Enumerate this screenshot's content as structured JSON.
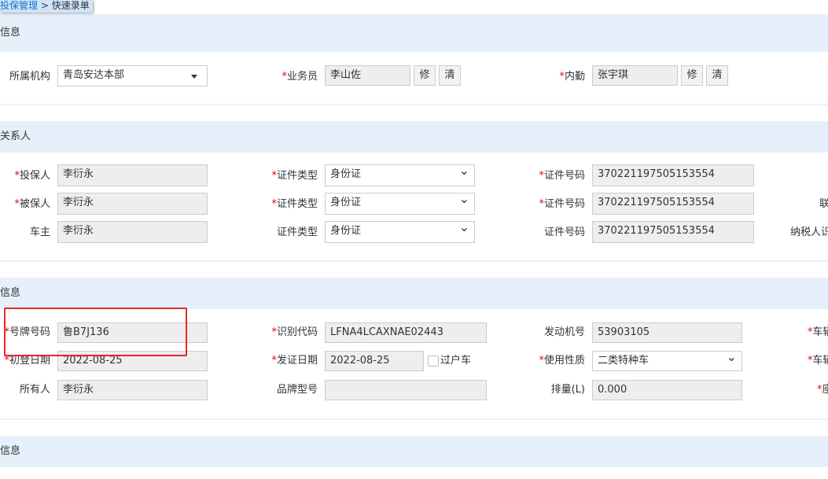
{
  "breadcrumb": {
    "link": "投保管理",
    "sep": " > ",
    "current": "快速录单"
  },
  "sections": [
    "本信息",
    "险关系人",
    "辆信息",
    "险信息"
  ],
  "basic": {
    "org_label": "所属机构",
    "org_value": "青岛安达本部",
    "sales_label": "业务员",
    "sales_value": "李山佐",
    "inner_label": "内勤",
    "inner_value": "张宇琪",
    "edit_btn": "修",
    "clear_btn": "清"
  },
  "parties": [
    {
      "role": "投保人",
      "required": true,
      "name": "李衍永",
      "idtype_label": "证件类型",
      "idtype": "身份证",
      "idno_label": "证件号码",
      "idno": "370221197505153554",
      "extra": ""
    },
    {
      "role": "被保人",
      "required": true,
      "name": "李衍永",
      "idtype_label": "证件类型",
      "idtype": "身份证",
      "idno_label": "证件号码",
      "idno": "370221197505153554",
      "extra": "联"
    },
    {
      "role": "车主",
      "required": false,
      "name": "李衍永",
      "idtype_label": "证件类型",
      "idtype": "身份证",
      "idno_label": "证件号码",
      "idno": "370221197505153554",
      "extra": "纳税人识"
    }
  ],
  "vehicle": {
    "plate_label": "号牌号码",
    "plate": "鲁B7J136",
    "vin_label": "识别代码",
    "vin": "LFNA4LCAXNAE02443",
    "engine_label": "发动机号",
    "engine": "53903105",
    "c4r1": "车辆",
    "reg_label": "初登日期",
    "reg": "2022-08-25",
    "issue_label": "发证日期",
    "issue": "2022-08-25",
    "transfer_label": "过户车",
    "usage_label": "使用性质",
    "usage": "二类特种车",
    "c4r2": "车辆",
    "owner_label": "所有人",
    "owner": "李衍永",
    "brand_label": "品牌型号",
    "brand": "",
    "disp_label": "排量(L)",
    "disp": "0.000",
    "c4r3": "座"
  }
}
